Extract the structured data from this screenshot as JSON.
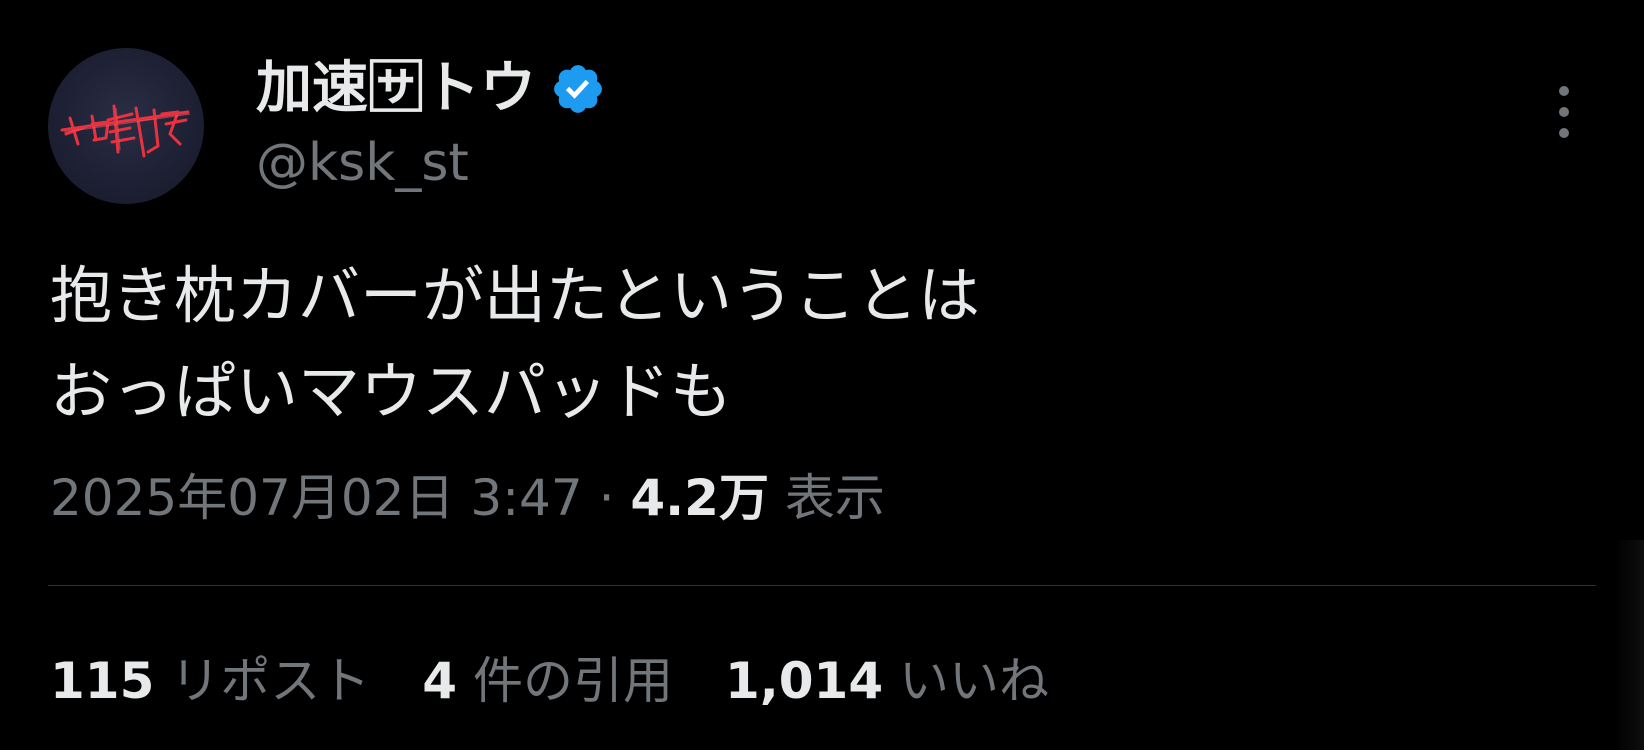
{
  "user": {
    "display_name": "加速🈂トウ",
    "handle": "@ksk_st",
    "verified": true,
    "avatar_icon": "avatar-logo-icon",
    "verified_icon": "verified-badge-icon"
  },
  "menu": {
    "more_icon": "more-vertical-icon"
  },
  "tweet": {
    "lines": [
      "抱き枕カバーが出たということは",
      "おっぱいマウスパッドも"
    ],
    "timestamp": "2025年07月02日 3:47",
    "separator": "·",
    "views_count": "4.2万",
    "views_label": "表示"
  },
  "stats": {
    "reposts_count": "115",
    "reposts_label": "リポスト",
    "quotes_count": "4",
    "quotes_label": "件の引用",
    "likes_count": "1,014",
    "likes_label": "いいね"
  },
  "colors": {
    "background": "#000000",
    "primary_text": "#e7e9ea",
    "secondary_text": "#71767b",
    "divider": "#2f3336",
    "verified_blue": "#1d9bf0",
    "avatar_red": "#e8323f"
  }
}
